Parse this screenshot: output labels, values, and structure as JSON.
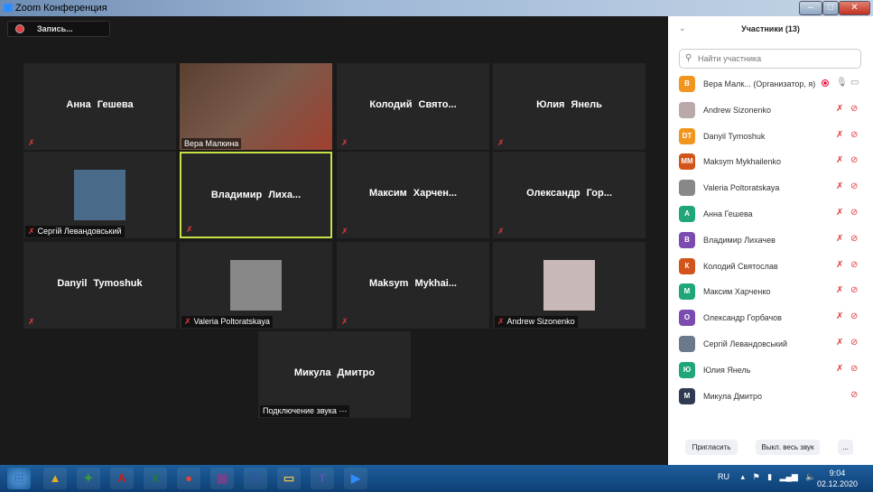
{
  "window": {
    "title": "Zoom Конференция",
    "minimize": "–",
    "maximize": "□",
    "close": "✕"
  },
  "recording": {
    "label": "Запись..."
  },
  "tiles": [
    {
      "name": "Анна Гешева",
      "mode": "name",
      "muted": true
    },
    {
      "name": "Вера Малкина",
      "mode": "video",
      "muted": false,
      "color": "#7a5a4a"
    },
    {
      "name": "Колодий  Свято...",
      "mode": "name",
      "muted": true
    },
    {
      "name": "Юлия Янель",
      "mode": "name",
      "muted": true
    },
    {
      "name": "Сергій Левандовський",
      "mode": "photo",
      "muted": true,
      "color": "#4a6a8a"
    },
    {
      "name": "Владимир  Лиха...",
      "mode": "name",
      "muted": true,
      "active": true
    },
    {
      "name": "Максим  Харчен...",
      "mode": "name",
      "muted": true
    },
    {
      "name": "Олександр  Гор...",
      "mode": "name",
      "muted": true
    },
    {
      "name": "Danyil Tymoshuk",
      "mode": "name",
      "muted": true
    },
    {
      "name": "Valeria Poltoratskaya",
      "mode": "photo",
      "muted": true,
      "color": "#888"
    },
    {
      "name": "Maksym  Mykhai...",
      "mode": "name",
      "muted": true
    },
    {
      "name": "Andrew Sizonenko",
      "mode": "photo",
      "muted": true,
      "color": "#c9b8b8"
    },
    {
      "name": "Микула Дмитро",
      "mode": "name",
      "muted": false,
      "status": "Подключение звука ⋯"
    }
  ],
  "panel": {
    "title": "Участники (13)",
    "search_placeholder": "Найти участника",
    "invite": "Пригласить",
    "mute_all": "Выкл. весь звук",
    "more": "..."
  },
  "participants": [
    {
      "initials": "В",
      "name": "Вера Малк... (Организатор, я)",
      "color": "#f0961e",
      "mic": "on",
      "cam": "on",
      "recording": true
    },
    {
      "initials": "",
      "name": "Andrew Sizonenko",
      "color": "#b9a9a9",
      "mic": "muted",
      "cam": "off"
    },
    {
      "initials": "DT",
      "name": "Danyil Tymoshuk",
      "color": "#f0961e",
      "mic": "muted",
      "cam": "off"
    },
    {
      "initials": "MM",
      "name": "Maksym Mykhailenko",
      "color": "#d2541a",
      "mic": "muted",
      "cam": "off"
    },
    {
      "initials": "",
      "name": "Valeria Poltoratskaya",
      "color": "#888888",
      "mic": "muted",
      "cam": "off"
    },
    {
      "initials": "А",
      "name": "Анна Гешева",
      "color": "#21a67a",
      "mic": "muted",
      "cam": "off"
    },
    {
      "initials": "В",
      "name": "Владимир Лихачев",
      "color": "#7b4bb0",
      "mic": "muted",
      "cam": "off"
    },
    {
      "initials": "К",
      "name": "Колодий Святослав",
      "color": "#d2541a",
      "mic": "muted",
      "cam": "off"
    },
    {
      "initials": "М",
      "name": "Максим Харченко",
      "color": "#21a67a",
      "mic": "muted",
      "cam": "off"
    },
    {
      "initials": "О",
      "name": "Олександр Горбачов",
      "color": "#7b4bb0",
      "mic": "muted",
      "cam": "off"
    },
    {
      "initials": "",
      "name": "Сергій Левандовський",
      "color": "#6a7a8a",
      "mic": "muted",
      "cam": "off"
    },
    {
      "initials": "Ю",
      "name": "Юлия Янель",
      "color": "#21a67a",
      "mic": "muted",
      "cam": "off"
    },
    {
      "initials": "М",
      "name": "Микула Дмитро",
      "color": "#2f3b52",
      "mic": "none",
      "cam": "off"
    }
  ],
  "taskbar": {
    "apps": [
      {
        "name": "start",
        "glyph": "⊞",
        "color": "#3a7ac0"
      },
      {
        "name": "archicad",
        "glyph": "▲",
        "color": "#e8b020"
      },
      {
        "name": "app3",
        "glyph": "✦",
        "color": "#3a9a3a"
      },
      {
        "name": "pdf",
        "glyph": "A",
        "color": "#c02020"
      },
      {
        "name": "excel",
        "glyph": "X",
        "color": "#1e7a44"
      },
      {
        "name": "chrome",
        "glyph": "●",
        "color": "#dd4433"
      },
      {
        "name": "winrar",
        "glyph": "▤",
        "color": "#8a3a8a"
      },
      {
        "name": "word",
        "glyph": "W",
        "color": "#2b579a"
      },
      {
        "name": "explorer",
        "glyph": "▭",
        "color": "#e8c050"
      },
      {
        "name": "teams",
        "glyph": "T",
        "color": "#5558af"
      },
      {
        "name": "zoom",
        "glyph": "▶",
        "color": "#2d8cff"
      }
    ],
    "lang": "RU",
    "time": "9:04",
    "date": "02.12.2020"
  }
}
